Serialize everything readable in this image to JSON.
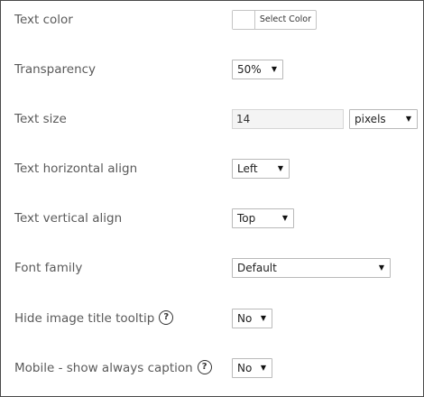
{
  "fields": {
    "text_color": {
      "label": "Text color",
      "button_label": "Select Color",
      "swatch_color": "#ffffff"
    },
    "transparency": {
      "label": "Transparency",
      "value": "50%"
    },
    "text_size": {
      "label": "Text size",
      "value": "14",
      "unit": "pixels"
    },
    "text_h_align": {
      "label": "Text horizontal align",
      "value": "Left"
    },
    "text_v_align": {
      "label": "Text vertical align",
      "value": "Top"
    },
    "font_family": {
      "label": "Font family",
      "value": "Default"
    },
    "hide_tooltip": {
      "label": "Hide image title tooltip",
      "value": "No",
      "help_icon": "question-circle"
    },
    "mobile_caption": {
      "label": "Mobile - show always caption",
      "value": "No",
      "help_icon": "question-circle"
    }
  }
}
